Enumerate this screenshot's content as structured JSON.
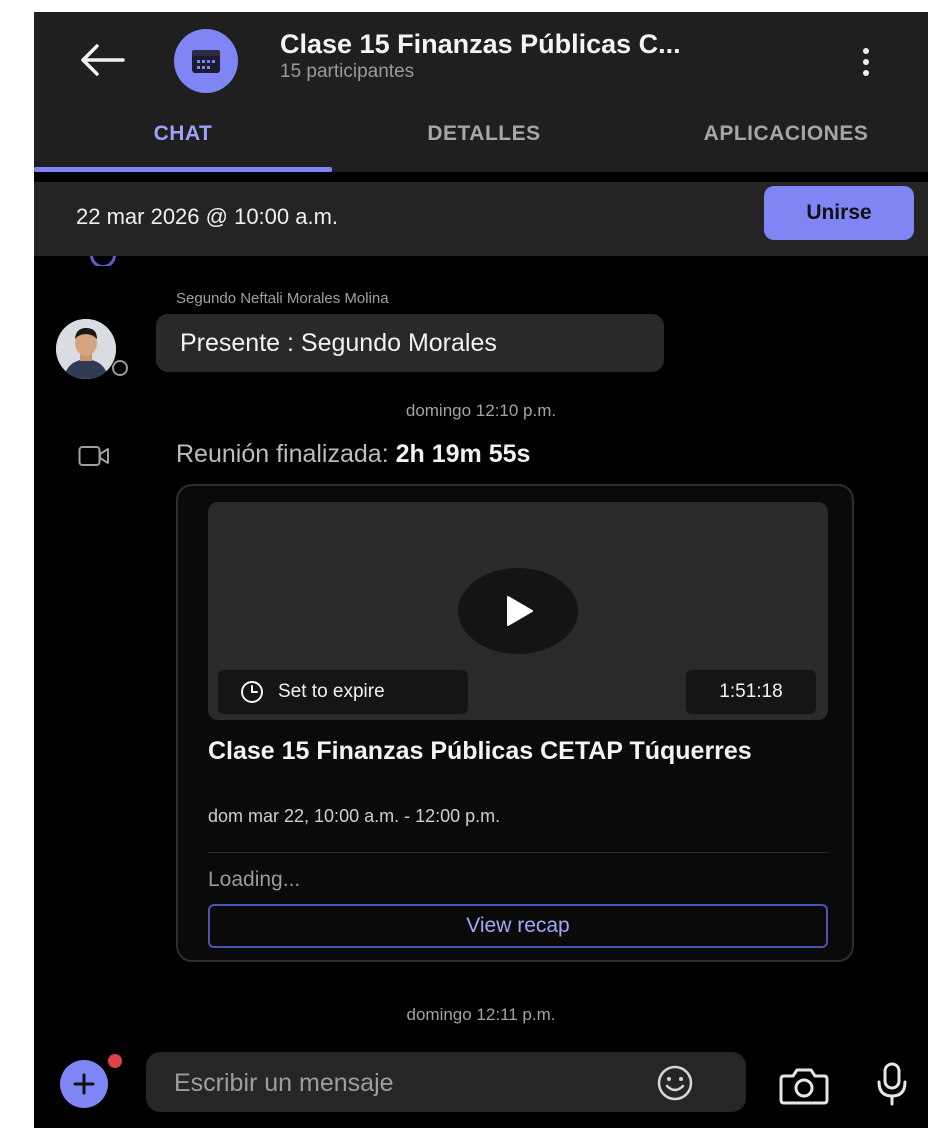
{
  "header": {
    "back_icon": "arrow-left-icon",
    "avatar_icon": "calendar-icon",
    "title": "Clase 15 Finanzas Públicas C...",
    "subtitle": "15 participantes",
    "more_icon": "more-vertical-icon"
  },
  "tabs": [
    {
      "label": "CHAT",
      "active": true
    },
    {
      "label": "DETALLES",
      "active": false
    },
    {
      "label": "APLICACIONES",
      "active": false
    }
  ],
  "meeting_bar": {
    "date": "22 mar 2026 @ 10:00 a.m.",
    "join_label": "Unirse"
  },
  "messages": {
    "sender": "Segundo Neftali Morales Molina",
    "text": "Presente : Segundo Morales",
    "time1": "domingo 12:10 p.m.",
    "ended_prefix": "Reunión finalizada: ",
    "ended_duration": "2h 19m 55s",
    "time2": "domingo 12:11 p.m."
  },
  "recording": {
    "expire_label": "Set to expire",
    "duration": "1:51:18",
    "title": "Clase 15 Finanzas Públicas CETAP Túquerres",
    "time_range": "dom mar 22, 10:00 a.m. - 12:00 p.m.",
    "loading": "Loading...",
    "recap_label": "View recap"
  },
  "composer": {
    "placeholder": "Escribir un mensaje"
  },
  "colors": {
    "accent": "#7f85f5",
    "background": "#000000",
    "header": "#1f1f1f",
    "notification": "#e0424d"
  }
}
